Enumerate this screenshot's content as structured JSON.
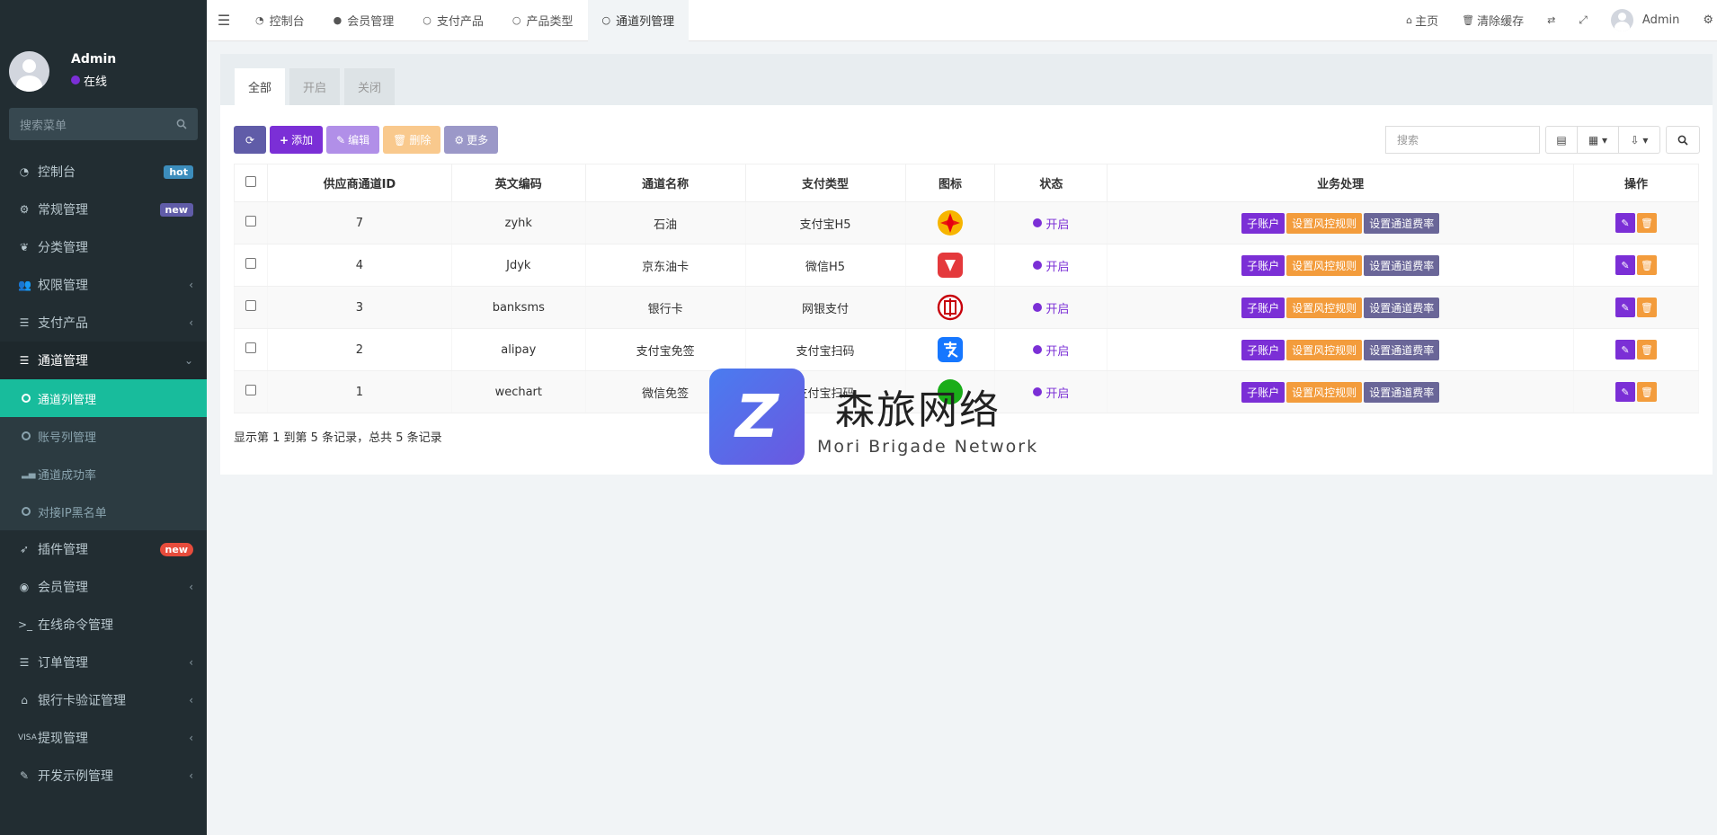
{
  "user": {
    "name": "Admin",
    "status": "在线"
  },
  "sidebar": {
    "search_placeholder": "搜索菜单",
    "items": [
      {
        "label": "控制台",
        "icon": "dashboard-icon",
        "badge": "hot"
      },
      {
        "label": "常规管理",
        "icon": "cogs-icon",
        "badge": "new"
      },
      {
        "label": "分类管理",
        "icon": "leaf-icon"
      },
      {
        "label": "权限管理",
        "icon": "group-icon"
      },
      {
        "label": "支付产品",
        "icon": "list-icon"
      },
      {
        "label": "通道管理",
        "icon": "list-icon"
      }
    ],
    "sub_items": [
      {
        "label": "通道列管理"
      },
      {
        "label": "账号列管理"
      },
      {
        "label": "通道成功率"
      },
      {
        "label": "对接IP黑名单"
      }
    ],
    "items2": [
      {
        "label": "插件管理",
        "icon": "rocket-icon",
        "badge": "new"
      },
      {
        "label": "会员管理",
        "icon": "user-circle-icon"
      },
      {
        "label": "在线命令管理",
        "icon": "terminal-icon"
      },
      {
        "label": "订单管理",
        "icon": "list-icon"
      },
      {
        "label": "银行卡验证管理",
        "icon": "bank-icon"
      },
      {
        "label": "提现管理",
        "icon": "visa-icon"
      },
      {
        "label": "开发示例管理",
        "icon": "magic-icon"
      }
    ]
  },
  "topnav": {
    "tabs": [
      {
        "label": "控制台"
      },
      {
        "label": "会员管理"
      },
      {
        "label": "支付产品"
      },
      {
        "label": "产品类型"
      },
      {
        "label": "通道列管理"
      }
    ],
    "home": "主页",
    "clear_cache": "清除缓存",
    "admin": "Admin"
  },
  "panel": {
    "tabs": [
      "全部",
      "开启",
      "关闭"
    ],
    "toolbar": {
      "add": "添加",
      "edit": "编辑",
      "delete": "删除",
      "more": "更多"
    },
    "search_placeholder": "搜索"
  },
  "table": {
    "headers": [
      "供应商通道ID",
      "英文编码",
      "通道名称",
      "支付类型",
      "图标",
      "状态",
      "业务处理",
      "操作"
    ],
    "rows": [
      {
        "id": "7",
        "code": "zyhk",
        "name": "石油",
        "pay_type": "支付宝H5",
        "icon": "petrochina-logo",
        "status": "开启"
      },
      {
        "id": "4",
        "code": "Jdyk",
        "name": "京东油卡",
        "pay_type": "微信H5",
        "icon": "jd-card-logo",
        "status": "开启"
      },
      {
        "id": "3",
        "code": "banksms",
        "name": "银行卡",
        "pay_type": "网银支付",
        "icon": "icbc-logo",
        "status": "开启"
      },
      {
        "id": "2",
        "code": "alipay",
        "name": "支付宝免签",
        "pay_type": "支付宝扫码",
        "icon": "alipay-logo",
        "status": "开启"
      },
      {
        "id": "1",
        "code": "wechart",
        "name": "微信免签",
        "pay_type": "支付宝扫码",
        "icon": "wechat-logo",
        "status": "开启"
      }
    ],
    "actions": {
      "sub_account": "子账户",
      "risk_rules": "设置风控规则",
      "rate": "设置通道费率"
    }
  },
  "footer": "显示第 1 到第 5 条记录，总共 5 条记录",
  "watermark": {
    "cn": "森旅网络",
    "en": "Mori Brigade Network"
  }
}
